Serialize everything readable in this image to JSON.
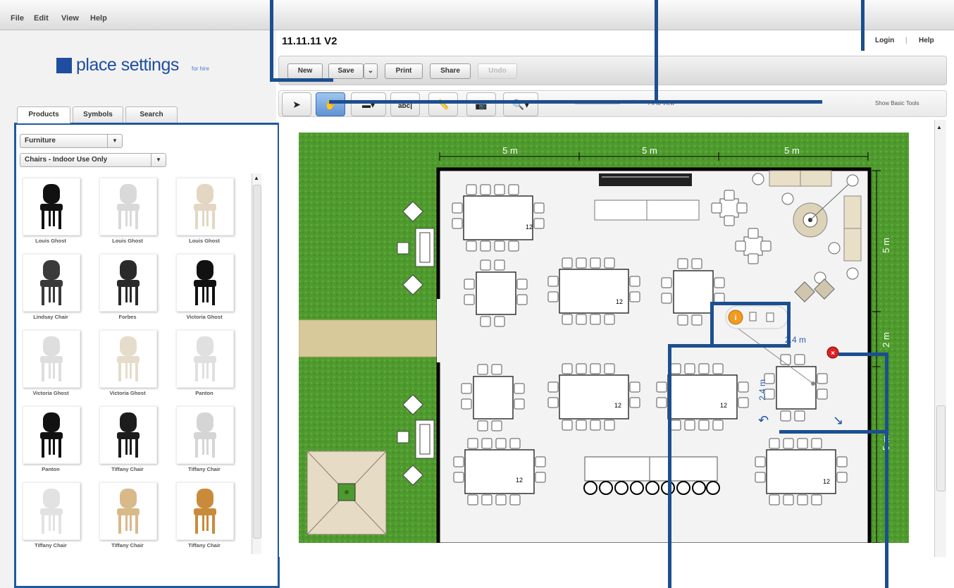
{
  "menu": {
    "file": "File",
    "edit": "Edit",
    "view": "View",
    "help": "Help"
  },
  "brand": {
    "name": "place settings",
    "sub": "for hire"
  },
  "document": {
    "title": "11.11.11  V2"
  },
  "header_links": {
    "login": "Login",
    "help": "Help"
  },
  "toolbar": {
    "new": "New",
    "save": "Save",
    "print": "Print",
    "share": "Share",
    "undo": "Undo"
  },
  "tools": {
    "zoom_minus": "−",
    "zoom_plus": "+",
    "fit": "Fit to View",
    "basic": "Show Basic Tools"
  },
  "tabs": {
    "products": "Products",
    "symbols": "Symbols",
    "search": "Search"
  },
  "filters": {
    "category": "Furniture",
    "subcategory": "Chairs - Indoor Use Only"
  },
  "products": [
    {
      "label": "Louis Ghost",
      "color": "#111111"
    },
    {
      "label": "Louis Ghost",
      "color": "#d9d9d9"
    },
    {
      "label": "Louis Ghost",
      "color": "#e3d7c3"
    },
    {
      "label": "Lindsay Chair",
      "color": "#3a3a3a"
    },
    {
      "label": "Forbes",
      "color": "#2a2a2a"
    },
    {
      "label": "Victoria Ghost",
      "color": "#111111"
    },
    {
      "label": "Victoria Ghost",
      "color": "#dedede"
    },
    {
      "label": "Victoria Ghost",
      "color": "#e6dccb"
    },
    {
      "label": "Panton",
      "color": "#e0e0e0"
    },
    {
      "label": "Panton",
      "color": "#111111"
    },
    {
      "label": "Tiffany Chair",
      "color": "#1c1c1c"
    },
    {
      "label": "Tiffany Chair",
      "color": "#d5d5d5"
    },
    {
      "label": "Tiffany Chair",
      "color": "#e2e2e2"
    },
    {
      "label": "Tiffany Chair",
      "color": "#d9b98a"
    },
    {
      "label": "Tiffany Chair",
      "color": "#c98b3a"
    }
  ],
  "plan": {
    "dim_top": [
      "5 m",
      "5 m",
      "5 m"
    ],
    "dim_right": [
      "5 m",
      "2 m",
      "5 m"
    ],
    "table_numbers": [
      "12",
      "12",
      "12",
      "12",
      "12",
      "12"
    ],
    "selected_width": "2.4 m",
    "selected_height": "2.4 m"
  },
  "colors": {
    "accent": "#1f4ea1",
    "callout": "#1c4f8f",
    "grass": "#4f9a2e"
  }
}
